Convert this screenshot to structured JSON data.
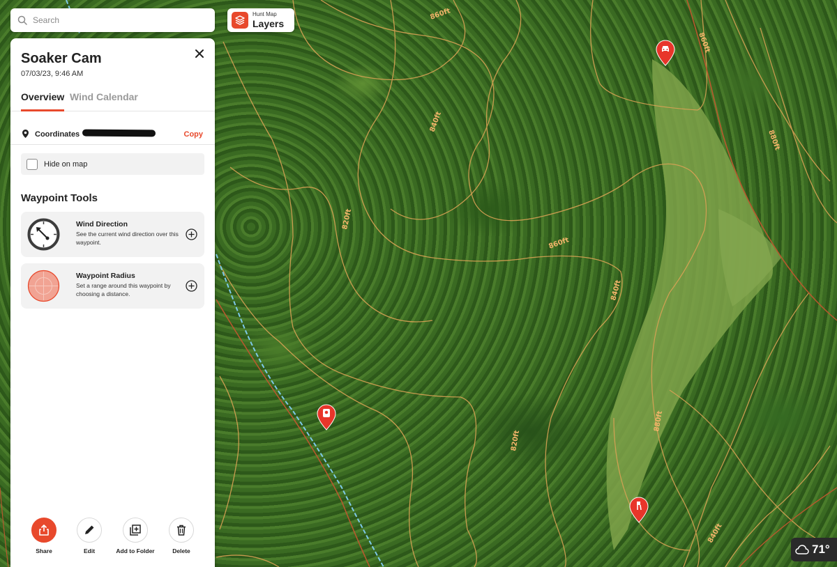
{
  "search": {
    "placeholder": "Search",
    "icon": "search-icon"
  },
  "layers": {
    "small": "Hunt Map",
    "big": "Layers",
    "icon": "layers-icon"
  },
  "panel": {
    "title": "Soaker Cam",
    "date": "07/03/23, 9:46 AM",
    "tabs": [
      {
        "label": "Overview",
        "active": true
      },
      {
        "label": "Wind Calendar",
        "active": false
      }
    ],
    "coordinates": {
      "label": "Coordinates",
      "copy": "Copy"
    },
    "hide_on_map": {
      "label": "Hide on map",
      "checked": false
    },
    "tools_heading": "Waypoint Tools",
    "tools": [
      {
        "name": "Wind Direction",
        "description": "See the current wind direction over this waypoint.",
        "icon": "wind-direction-icon"
      },
      {
        "name": "Waypoint Radius",
        "description": "Set a range around this waypoint by choosing a distance.",
        "icon": "radius-icon"
      }
    ],
    "actions": [
      {
        "label": "Share",
        "icon": "share-icon"
      },
      {
        "label": "Edit",
        "icon": "pencil-icon"
      },
      {
        "label": "Add to Folder",
        "icon": "add-folder-icon"
      },
      {
        "label": "Delete",
        "icon": "trash-icon"
      }
    ]
  },
  "map": {
    "contour_labels": [
      "860ft",
      "860ft",
      "860ft",
      "840ft",
      "820ft",
      "840ft",
      "820ft",
      "880ft",
      "840ft",
      "880ft"
    ],
    "waypoints": [
      {
        "icon": "vehicle-icon"
      },
      {
        "icon": "trail-camera-icon"
      },
      {
        "icon": "stand-icon"
      }
    ]
  },
  "weather": {
    "temperature": "71°",
    "icon": "cloud-icon"
  },
  "colors": {
    "accent": "#e8492c",
    "contour": "#d9a255"
  }
}
